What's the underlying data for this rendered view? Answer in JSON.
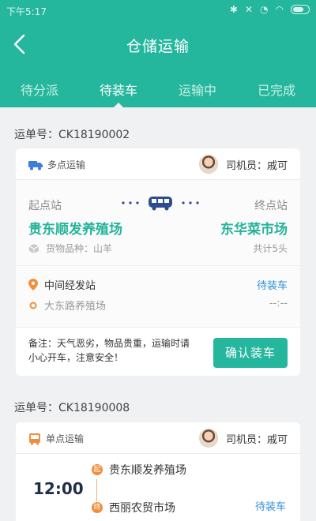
{
  "status_bar": {
    "time": "下午5:17"
  },
  "header": {
    "title": "仓储运输"
  },
  "tabs": [
    {
      "label": "待分派"
    },
    {
      "label": "待装车"
    },
    {
      "label": "运输中"
    },
    {
      "label": "已完成"
    }
  ],
  "active_tab": "待装车",
  "orders": [
    {
      "order_no": "运单号：CK18190002",
      "type": "多点运输",
      "driver": "司机员：戚可",
      "start_label": "起点站",
      "start": "贵东顺发养殖场",
      "end_label": "终点站",
      "end": "东华菜市场",
      "goods": "货物品种：山羊",
      "total": "共计5头",
      "mid_title": "中间经发站",
      "mid_status": "待装车",
      "mid_place": "大东路养殖场",
      "mid_dash": "--:--",
      "note": "备注：天气恶劣，物品贵重，运输时请小心开车，注意安全！",
      "button": "确认装车"
    },
    {
      "order_no": "运单号：CK18190008",
      "type": "单点运输",
      "driver": "司机员：戚可",
      "time": "12:00",
      "from_badge": "起",
      "from": "贵东顺发养殖场",
      "to_badge": "终",
      "to": "西丽农贸市场",
      "status": "待装车"
    }
  ],
  "colors": {
    "primary": "#25b79e",
    "link": "#2f8fd8",
    "orange": "#f28d3c"
  }
}
